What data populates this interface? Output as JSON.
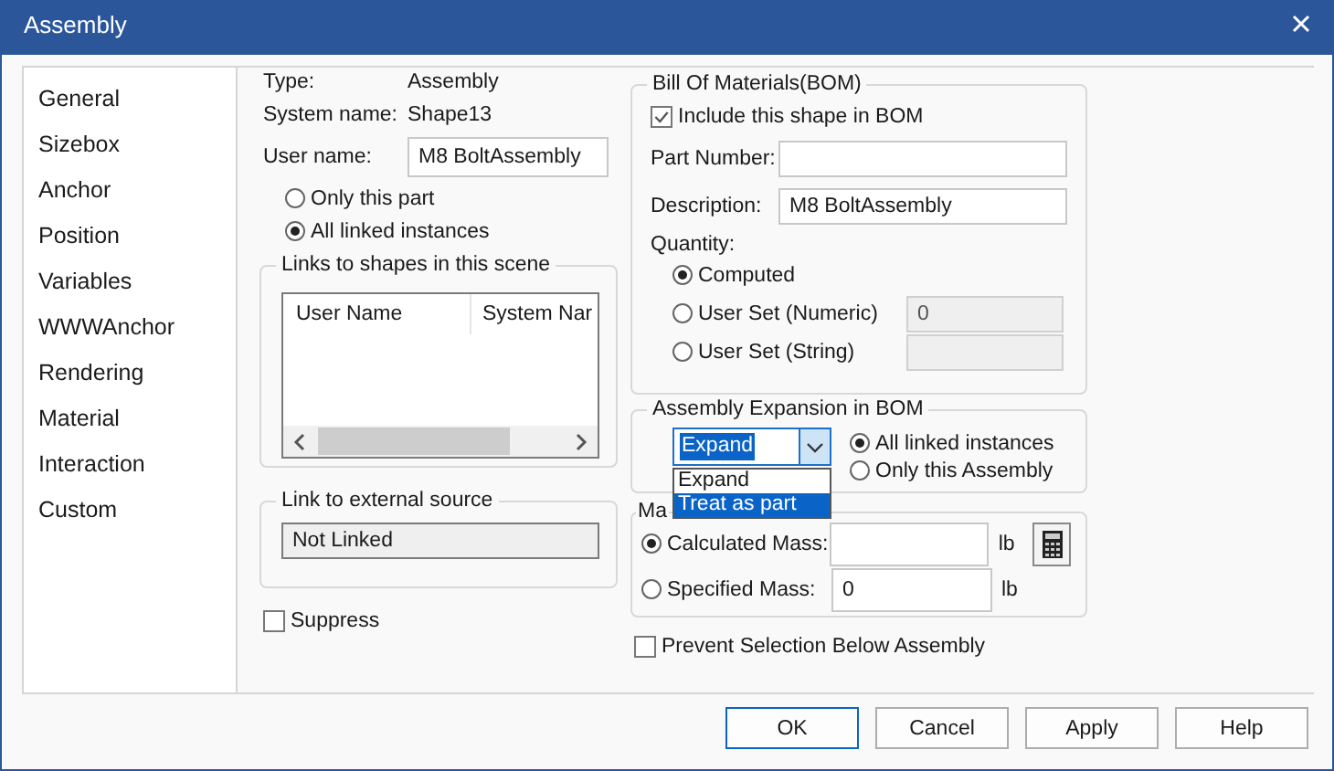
{
  "window": {
    "title": "Assembly"
  },
  "sidebar": {
    "items": [
      {
        "label": "General"
      },
      {
        "label": "Sizebox"
      },
      {
        "label": "Anchor"
      },
      {
        "label": "Position"
      },
      {
        "label": "Variables"
      },
      {
        "label": "WWWAnchor"
      },
      {
        "label": "Rendering"
      },
      {
        "label": "Material"
      },
      {
        "label": "Interaction"
      },
      {
        "label": "Custom"
      }
    ]
  },
  "general": {
    "type_label": "Type:",
    "type_value": "Assembly",
    "system_name_label": "System name:",
    "system_name_value": "Shape13",
    "user_name_label": "User name:",
    "user_name_value": "M8 BoltAssembly",
    "scope_options": [
      {
        "label": "Only this part",
        "selected": false
      },
      {
        "label": "All linked instances",
        "selected": true
      }
    ]
  },
  "links_group": {
    "legend": "Links to shapes in this scene",
    "columns": [
      "User Name",
      "System Nar"
    ]
  },
  "external_link": {
    "legend": "Link to external source",
    "value": "Not Linked"
  },
  "suppress": {
    "label": "Suppress",
    "checked": false
  },
  "bom": {
    "legend": "Bill Of Materials(BOM)",
    "include": {
      "label": "Include this shape in BOM",
      "checked": true
    },
    "part_number_label": "Part Number:",
    "description_label": "Description:",
    "description_value": "M8 BoltAssembly",
    "quantity_label": "Quantity:",
    "quantity_options": [
      {
        "label": "Computed",
        "selected": true
      },
      {
        "label": "User Set (Numeric)",
        "selected": false,
        "value": "0",
        "disabled": true
      },
      {
        "label": "User Set (String)",
        "selected": false,
        "disabled": true
      }
    ]
  },
  "expansion": {
    "legend": "Assembly Expansion in BOM",
    "combo_value": "Expand",
    "dropdown_options": [
      {
        "label": "Expand",
        "selected": false
      },
      {
        "label": "Treat as part",
        "selected": true
      }
    ],
    "scope_options": [
      {
        "label": "All linked instances",
        "selected": true
      },
      {
        "label": "Only this Assembly",
        "selected": false
      }
    ]
  },
  "mass": {
    "legend": "Ma",
    "options": [
      {
        "label": "Calculated Mass:",
        "selected": true,
        "unit": "lb"
      },
      {
        "label": "Specified Mass:",
        "selected": false,
        "value": "0",
        "unit": "lb"
      }
    ]
  },
  "prevent_selection": {
    "label": "Prevent Selection Below Assembly",
    "checked": false
  },
  "buttons": [
    {
      "label": "OK",
      "default": true
    },
    {
      "label": "Cancel",
      "default": false
    },
    {
      "label": "Apply",
      "default": false
    },
    {
      "label": "Help",
      "default": false
    }
  ]
}
